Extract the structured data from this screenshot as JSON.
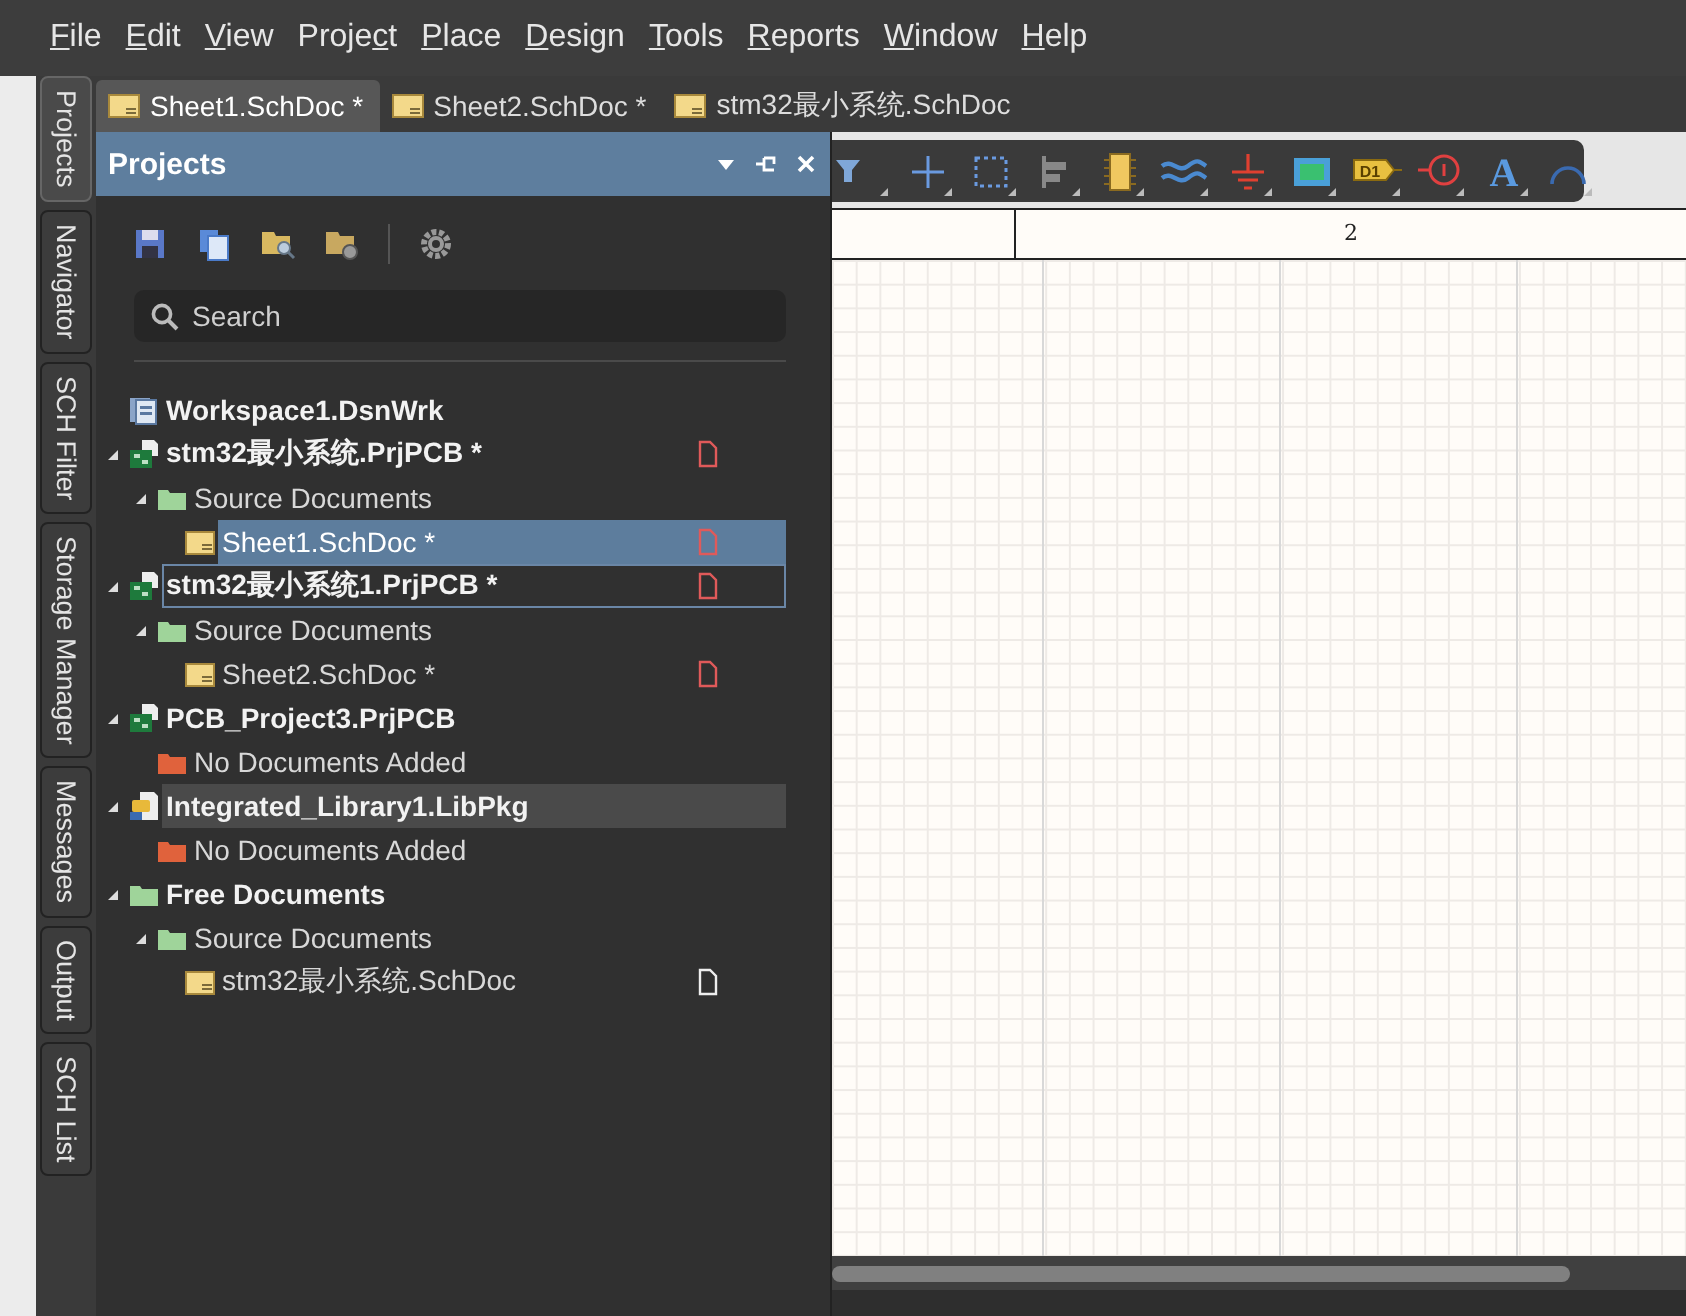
{
  "menu": [
    {
      "key": "F",
      "post": "ile"
    },
    {
      "key": "E",
      "post": "dit"
    },
    {
      "key": "V",
      "post": "iew"
    },
    {
      "pre": "Proje",
      "key": "c",
      "post": "t"
    },
    {
      "key": "P",
      "post": "lace"
    },
    {
      "key": "D",
      "post": "esign"
    },
    {
      "key": "T",
      "post": "ools"
    },
    {
      "key": "R",
      "post": "eports"
    },
    {
      "key": "W",
      "post": "indow"
    },
    {
      "key": "H",
      "post": "elp"
    }
  ],
  "side_tabs": [
    {
      "label": "Projects",
      "selected": true
    },
    {
      "label": "Navigator",
      "selected": false
    },
    {
      "label": "SCH Filter",
      "selected": false
    },
    {
      "label": "Storage Manager",
      "selected": false
    },
    {
      "label": "Messages",
      "selected": false
    },
    {
      "label": "Output",
      "selected": false
    },
    {
      "label": "SCH List",
      "selected": false
    }
  ],
  "document_tabs": [
    {
      "label": "Sheet1.SchDoc *",
      "selected": true
    },
    {
      "label": "Sheet2.SchDoc *",
      "selected": false
    },
    {
      "label": "stm32最小系统.SchDoc",
      "selected": false
    }
  ],
  "panel": {
    "title": "Projects",
    "search": {
      "placeholder": "Search"
    },
    "tree": [
      {
        "kind": "workspace",
        "label": "Workspace1.DsnWrk",
        "bold": true,
        "selected": false,
        "focused": false,
        "highlighted": false
      },
      {
        "kind": "project",
        "label": "stm32最小系统.PrjPCB *",
        "bold": true,
        "modified": true,
        "expanded": true,
        "selected": false,
        "focused": false,
        "highlighted": false,
        "children": [
          {
            "kind": "folder",
            "label": "Source Documents",
            "bold": false,
            "expanded": true,
            "selected": false,
            "focused": false,
            "highlighted": false,
            "children": [
              {
                "kind": "sheet",
                "label": "Sheet1.SchDoc *",
                "bold": false,
                "modified": true,
                "selected": true,
                "focused": false,
                "highlighted": false
              }
            ]
          }
        ]
      },
      {
        "kind": "project",
        "label": "stm32最小系统1.PrjPCB *",
        "bold": true,
        "modified": true,
        "expanded": true,
        "selected": false,
        "focused": true,
        "highlighted": false,
        "children": [
          {
            "kind": "folder",
            "label": "Source Documents",
            "bold": false,
            "expanded": true,
            "selected": false,
            "focused": false,
            "highlighted": false,
            "children": [
              {
                "kind": "sheet",
                "label": "Sheet2.SchDoc *",
                "bold": false,
                "modified": true,
                "selected": false,
                "focused": false,
                "highlighted": false
              }
            ]
          }
        ]
      },
      {
        "kind": "project",
        "label": "PCB_Project3.PrjPCB",
        "bold": true,
        "expanded": true,
        "selected": false,
        "focused": false,
        "highlighted": false,
        "children": [
          {
            "kind": "empty-folder",
            "label": "No Documents Added",
            "bold": false,
            "selected": false,
            "focused": false,
            "highlighted": false
          }
        ]
      },
      {
        "kind": "library",
        "label": "Integrated_Library1.LibPkg",
        "bold": true,
        "expanded": true,
        "selected": false,
        "focused": false,
        "highlighted": true,
        "children": [
          {
            "kind": "empty-folder",
            "label": "No Documents Added",
            "bold": false,
            "selected": false,
            "focused": false,
            "highlighted": false
          }
        ]
      },
      {
        "kind": "folder",
        "label": "Free Documents",
        "bold": true,
        "expanded": true,
        "selected": false,
        "focused": false,
        "highlighted": false,
        "children": [
          {
            "kind": "folder",
            "label": "Source Documents",
            "bold": false,
            "expanded": true,
            "selected": false,
            "focused": false,
            "highlighted": false,
            "children": [
              {
                "kind": "sheet",
                "label": "stm32最小系统.SchDoc",
                "bold": false,
                "modified": false,
                "selected": false,
                "focused": false,
                "highlighted": false
              }
            ]
          }
        ]
      }
    ]
  },
  "toolbar": {
    "port_label": "D1",
    "text_tool_glyph": "A"
  },
  "ruler": {
    "column_2": "2"
  }
}
